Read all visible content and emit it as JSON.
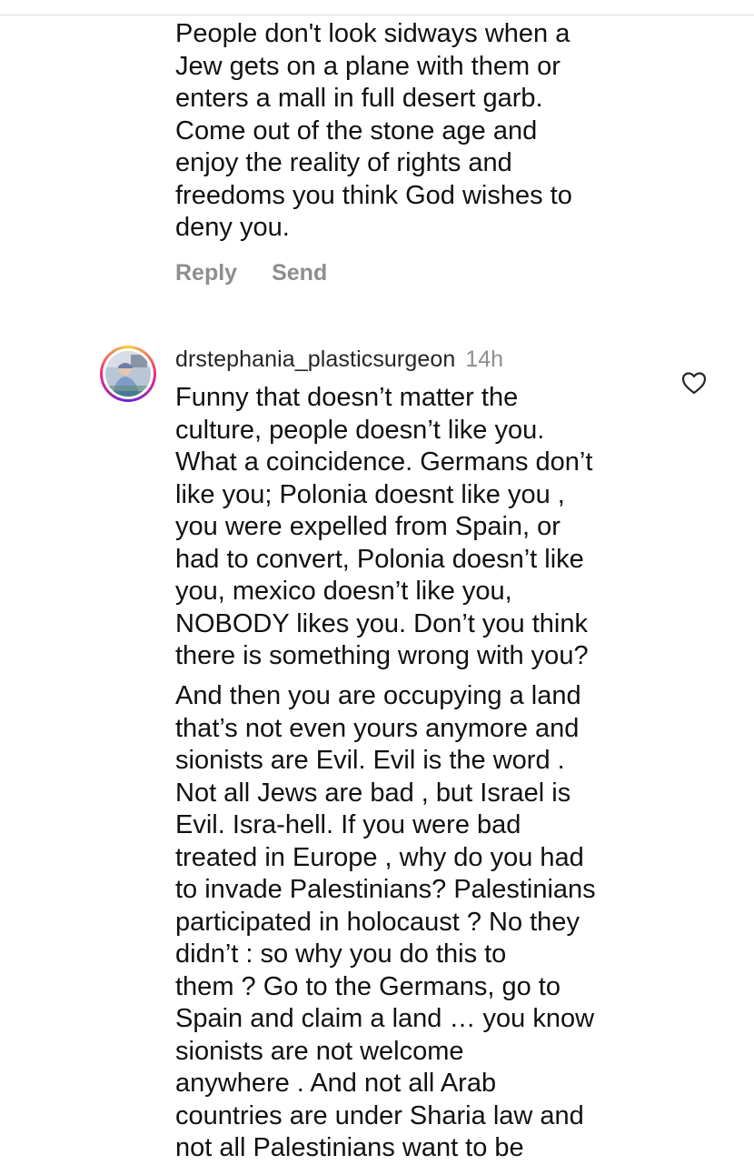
{
  "comments": [
    {
      "text_lines": [
        "People don't look sidways when a",
        "Jew gets on a plane with them or",
        "enters a mall in full desert garb.",
        "Come out of the stone age and",
        "enjoy the reality of rights and",
        "freedoms you think God wishes to",
        "deny you."
      ],
      "actions": {
        "reply_label": "Reply",
        "send_label": "Send"
      }
    },
    {
      "username": "drstephania_plasticsurgeon",
      "time": "14h",
      "paragraph1_lines": [
        "Funny that doesn’t matter the",
        "culture, people doesn’t like you.",
        "What a coincidence. Germans don’t",
        "like you; Polonia doesnt like you ,",
        "you were expelled from Spain, or",
        "had to convert, Polonia doesn’t like",
        "you, mexico doesn’t like you,",
        "NOBODY likes you. Don’t you think",
        "there is something wrong with you?"
      ],
      "paragraph2_lines": [
        "And then you are occupying a land",
        "that’s not even yours anymore and",
        "sionists are Evil. Evil is the word .",
        "Not all Jews are bad , but Israel is",
        "Evil. Isra-hell. If you were bad",
        "treated in Europe , why do you had",
        "to invade Palestinians? Palestinians",
        "participated in holocaust ? No they",
        "didn’t : so why you do this to",
        "them ? Go to the Germans, go to",
        "Spain and claim a land … you know",
        "sionists are not welcome",
        "anywhere . And not all Arab",
        "countries are under Sharia law and",
        "not all Palestinians want to be"
      ],
      "icons": {
        "avatar": "profile-photo",
        "like": "heart-outline-icon"
      }
    }
  ],
  "colors": {
    "text": "#111111",
    "muted": "#8e8e8e",
    "divider": "#dcdcdc"
  }
}
